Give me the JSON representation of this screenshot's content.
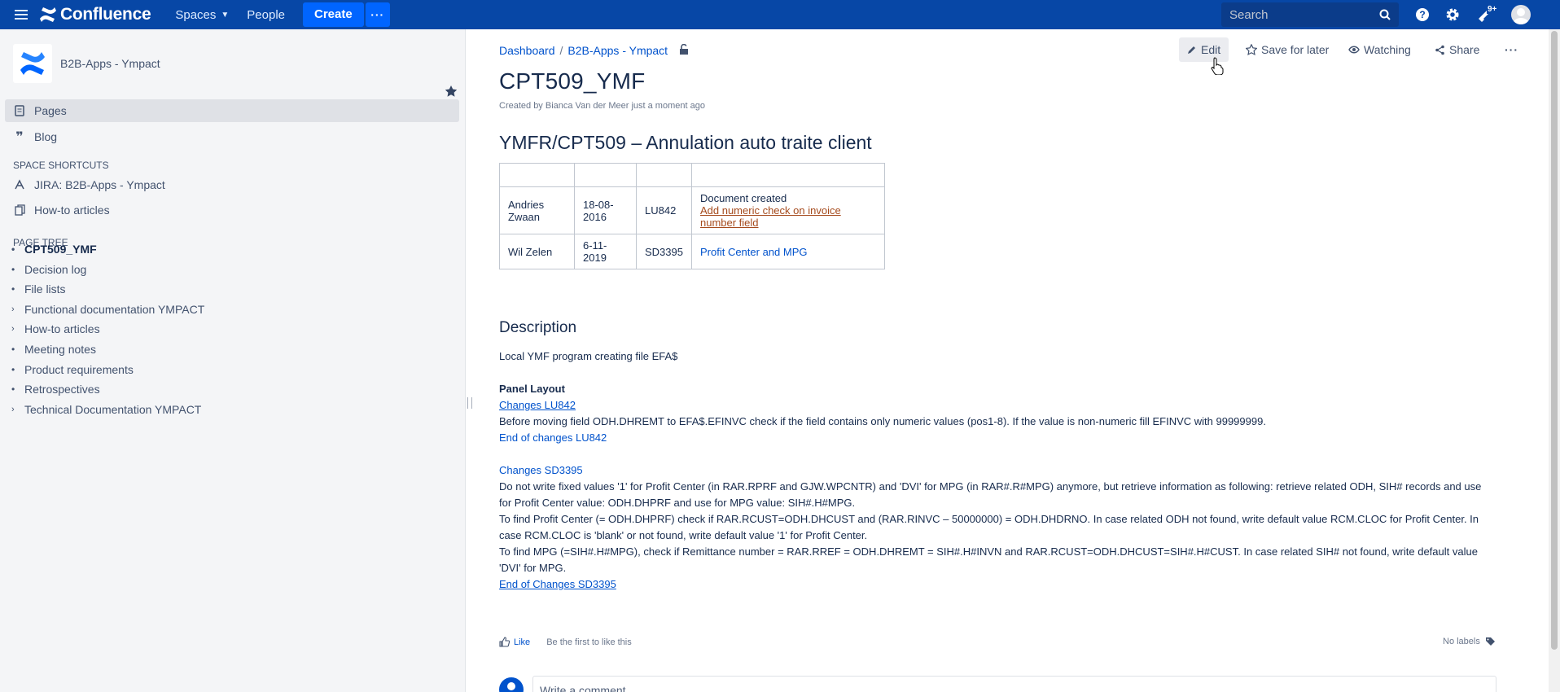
{
  "topbar": {
    "app_name": "Confluence",
    "nav": {
      "spaces": "Spaces",
      "people": "People"
    },
    "create": "Create",
    "search_placeholder": "Search",
    "notification_badge": "9+"
  },
  "sidebar": {
    "space_name": "B2B-Apps - Ympact",
    "pages": "Pages",
    "blog": "Blog",
    "shortcuts_heading": "SPACE SHORTCUTS",
    "shortcuts": [
      "JIRA: B2B-Apps - Ympact",
      "How-to articles"
    ],
    "tree_heading": "PAGE TREE",
    "tree": [
      {
        "label": "CPT509_YMF",
        "type": "bullet",
        "current": true
      },
      {
        "label": "Decision log",
        "type": "bullet"
      },
      {
        "label": "File lists",
        "type": "bullet"
      },
      {
        "label": "Functional documentation YMPACT",
        "type": "arrow"
      },
      {
        "label": "How-to articles",
        "type": "arrow"
      },
      {
        "label": "Meeting notes",
        "type": "bullet"
      },
      {
        "label": "Product requirements",
        "type": "bullet"
      },
      {
        "label": "Retrospectives",
        "type": "bullet"
      },
      {
        "label": "Technical Documentation YMPACT",
        "type": "arrow"
      }
    ]
  },
  "breadcrumb": {
    "dashboard": "Dashboard",
    "space": "B2B-Apps - Ympact"
  },
  "actions": {
    "edit": "Edit",
    "save": "Save for later",
    "watching": "Watching",
    "share": "Share"
  },
  "page": {
    "title": "CPT509_YMF",
    "byline": "Created by Bianca Van der Meer just a moment ago",
    "heading": "YMFR/CPT509 – Annulation auto traite client",
    "table": {
      "rows": [
        [
          "",
          "",
          "",
          ""
        ],
        [
          "Andries Zwaan",
          "18-08-2016",
          "LU842",
          "Document created"
        ],
        [
          "Wil Zelen",
          "6-11-2019",
          "SD3395",
          "Profit Center and MPG"
        ]
      ],
      "row1_link": "Add numeric check on invoice number field"
    },
    "description_heading": "Description",
    "description": {
      "intro": "Local YMF program creating file EFA$",
      "panel_layout": "Panel Layout",
      "changes_lu842": "Changes LU842",
      "lu842_text": "Before moving field ODH.DHREMT to EFA$.EFINVC check if the field contains only numeric values (pos1-8). If the value is non-numeric fill EFINVC with 99999999.",
      "end_lu842": "End of changes LU842",
      "changes_sd3395": "Changes SD3395",
      "sd3395_text1": "Do not write fixed values '1' for Profit Center (in RAR.RPRF and GJW.WPCNTR) and 'DVI' for MPG (in RAR#.R#MPG) anymore, but retrieve information as following: retrieve related ODH, SIH# records and use for Profit Center value: ODH.DHPRF and use for MPG value: SIH#.H#MPG.",
      "sd3395_text2": "To find Profit Center (= ODH.DHPRF) check if RAR.RCUST=ODH.DHCUST and (RAR.RINVC – 50000000) = ODH.DHDRNO. In case related ODH not found, write default value RCM.CLOC for Profit Center. In case RCM.CLOC is 'blank' or not found, write default value '1' for Profit Center.",
      "sd3395_text3": "To find MPG (=SIH#.H#MPG), check if Remittance number = RAR.RREF = ODH.DHREMT = SIH#.H#INVN and RAR.RCUST=ODH.DHCUST=SIH#.H#CUST. In case related SIH# not found, write default value 'DVI' for MPG.",
      "end_sd3395": "End of Changes SD3395"
    },
    "like": "Like",
    "like_hint": "Be the first to like this",
    "no_labels": "No labels",
    "comment_placeholder": "Write a comment..."
  }
}
